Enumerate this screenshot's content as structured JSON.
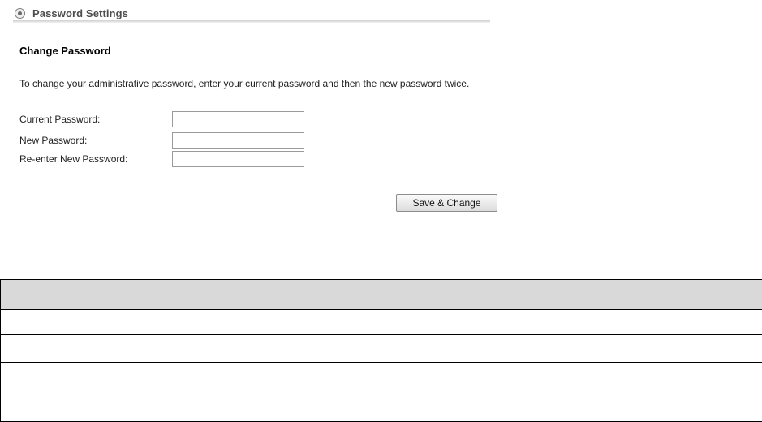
{
  "section": {
    "icon": "radio-circle-icon",
    "title": "Password Settings"
  },
  "form": {
    "heading": "Change Password",
    "description": "To change your administrative password, enter your current password and then the new password twice.",
    "fields": [
      {
        "label": "Current Password:",
        "value": ""
      },
      {
        "label": "New Password:",
        "value": ""
      },
      {
        "label": "Re-enter New Password:",
        "value": ""
      }
    ],
    "submit_label": "Save & Change"
  },
  "table": {
    "header_fill": "#d9d9d9",
    "header": [
      "",
      ""
    ],
    "rows": [
      [
        "",
        ""
      ],
      [
        "",
        ""
      ],
      [
        "",
        ""
      ],
      [
        "",
        ""
      ]
    ]
  }
}
